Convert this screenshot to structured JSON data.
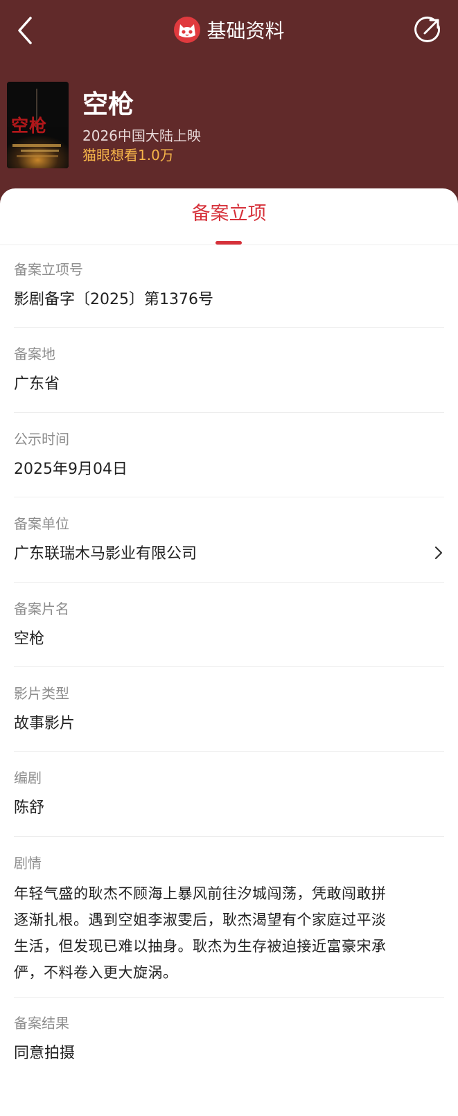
{
  "nav": {
    "title": "基础资料",
    "back_icon": "chevron-left-icon",
    "share_icon": "share-arrow-icon",
    "logo_icon": "maoyan-cat-logo"
  },
  "movie": {
    "poster_text": "空枪",
    "title": "空枪",
    "release": "2026中国大陆上映",
    "want_to_see": "猫眼想看1.0万"
  },
  "tab": {
    "label": "备案立项"
  },
  "fields": [
    {
      "label": "备案立项号",
      "value": "影剧备字〔2025〕第1376号"
    },
    {
      "label": "备案地",
      "value": "广东省"
    },
    {
      "label": "公示时间",
      "value": "2025年9月04日"
    },
    {
      "label": "备案单位",
      "value": "广东联瑞木马影业有限公司"
    },
    {
      "label": "备案片名",
      "value": "空枪"
    },
    {
      "label": "影片类型",
      "value": "故事影片"
    },
    {
      "label": "编剧",
      "value": "陈舒"
    },
    {
      "label": "剧情",
      "lines": [
        "年轻气盛的耿杰不顾海上暴风前往汐城闯荡，凭敢闯敢拼",
        "逐渐扎根。遇到空姐李淑雯后，耿杰渴望有个家庭过平淡",
        "生活，但发现已难以抽身。耿杰为生存被迫接近富豪宋承",
        "俨，不料卷入更大旋涡。"
      ]
    },
    {
      "label": "备案结果",
      "value": "同意拍摄"
    }
  ],
  "colors": {
    "header_bg": "#612a2a",
    "accent": "#d6313a",
    "want_color": "#f6b54a"
  }
}
